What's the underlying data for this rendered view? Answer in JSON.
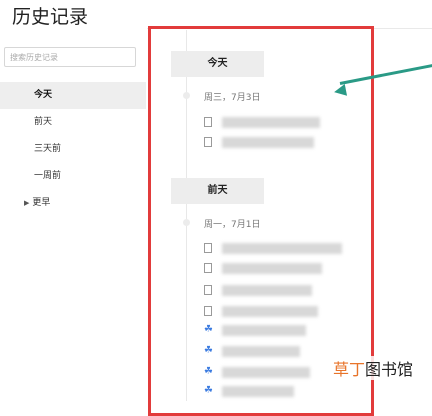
{
  "page": {
    "title": "历史记录"
  },
  "search": {
    "placeholder": "搜索历史记录"
  },
  "sidebar": {
    "items": [
      {
        "label": "今天",
        "active": true
      },
      {
        "label": "前天"
      },
      {
        "label": "三天前"
      },
      {
        "label": "一周前"
      },
      {
        "label": "更早"
      }
    ]
  },
  "groups": [
    {
      "header": "今天",
      "date": "周三，7月3日"
    },
    {
      "header": "前天",
      "date": "周一，7月1日"
    }
  ],
  "watermark": {
    "part1": "草丁",
    "part2": "图书馆"
  },
  "colors": {
    "highlight_box": "#e23b3b",
    "arrow": "#2a9a86",
    "paw_icon": "#3b7be0",
    "watermark_accent": "#e8742a"
  }
}
